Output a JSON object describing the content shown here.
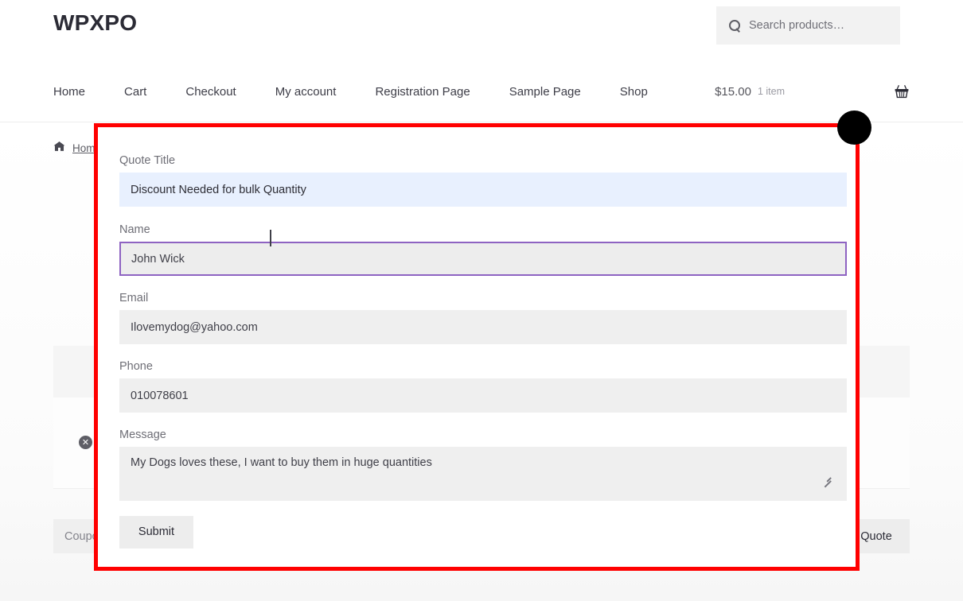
{
  "header": {
    "logo": "WPXPO",
    "search": {
      "icon": "search-icon",
      "placeholder": "Search products…",
      "value": ""
    }
  },
  "nav": {
    "items": [
      {
        "label": "Home"
      },
      {
        "label": "Cart"
      },
      {
        "label": "Checkout"
      },
      {
        "label": "My account"
      },
      {
        "label": "Registration Page"
      },
      {
        "label": "Sample Page"
      },
      {
        "label": "Shop"
      }
    ],
    "cart": {
      "amount": "$15.00",
      "count": "1 item",
      "icon": "shopping-basket-icon",
      "icon_glyph": "🧺"
    }
  },
  "page": {
    "breadcrumb": {
      "home_icon": "home-icon",
      "home_icon_glyph": "🏠",
      "home_label": "Home"
    },
    "cart_row": {
      "remove_icon": "remove-item-icon",
      "remove_glyph": "✕"
    },
    "coupon_placeholder": "Coupon code",
    "quote_button_label": "Request Quote"
  },
  "modal": {
    "close_icon": "close-modal-icon",
    "highlight_color": "#ff0000",
    "focus_border_color": "#8e63c2",
    "autofill_color": "#e8f0fe",
    "fields": {
      "quote_title": {
        "label": "Quote Title",
        "value": "Discount Needed for bulk Quantity",
        "placeholder": "Quote Title"
      },
      "name": {
        "label": "Name",
        "value": "John Wick",
        "placeholder": "Name"
      },
      "email": {
        "label": "Email",
        "value": "Ilovemydog@yahoo.com",
        "placeholder": "Email"
      },
      "phone": {
        "label": "Phone",
        "value": "010078601",
        "placeholder": "Phone"
      },
      "message": {
        "label": "Message",
        "value": "My Dogs loves these, I want to buy them in huge quantities",
        "placeholder": "Message"
      }
    },
    "submit_label": "Submit"
  }
}
